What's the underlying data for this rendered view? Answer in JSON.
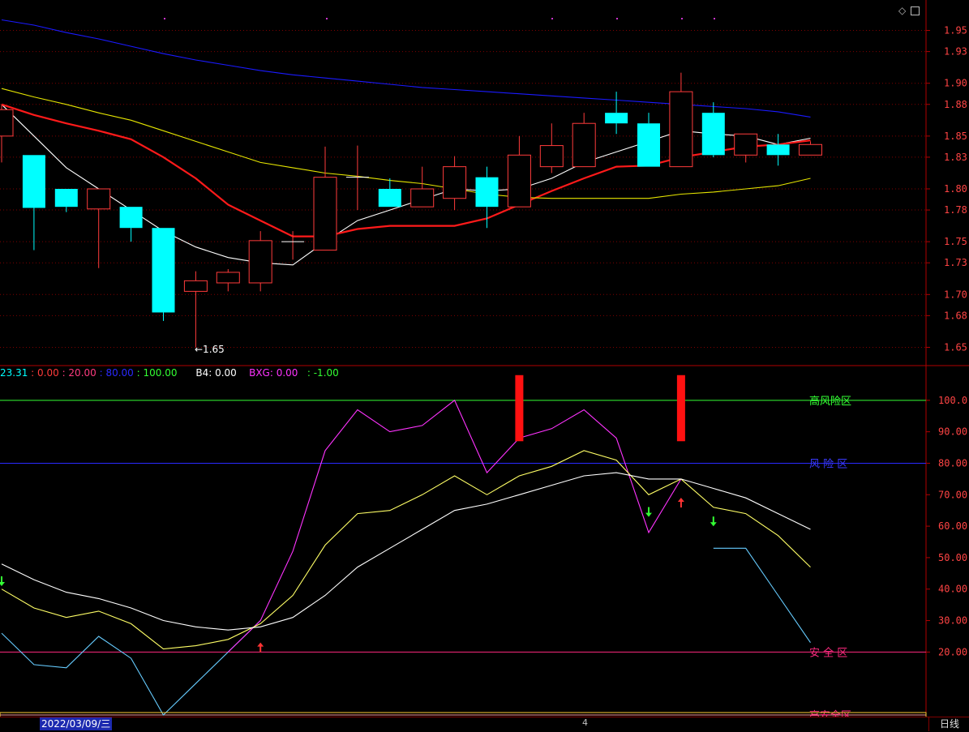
{
  "colors": {
    "up": "#ff3b3b",
    "down": "#00ffff",
    "ma_short": "#ffffff",
    "ma_red": "#ff1a1a",
    "ma_yellow": "#e6e600",
    "ma_blue": "#1a1aff",
    "grid": "#800000",
    "axis": "#b00000",
    "osc_magenta": "#ff33ff",
    "osc_cyan": "#66ccff",
    "osc_yellow": "#ffff66",
    "osc_white": "#ffffff"
  },
  "window_icons": [
    "diamond-icon",
    "restore-icon"
  ],
  "price_axis": {
    "ticks": [
      "1.95",
      "1.93",
      "1.90",
      "1.88",
      "1.85",
      "1.83",
      "1.80",
      "1.78",
      "1.75",
      "1.73",
      "1.70",
      "1.68",
      "1.65"
    ]
  },
  "low_marker": "←1.65",
  "legend": [
    {
      "text": "23.31",
      "color": "#00ffff"
    },
    {
      "text": " : 0.00",
      "color": "#ff3b3b"
    },
    {
      "text": " : 20.00",
      "color": "#ff3b7f"
    },
    {
      "text": " : 80.00",
      "color": "#2a2aff"
    },
    {
      "text": " : 100.00",
      "color": "#33ff33"
    },
    {
      "text": "      B4: 0.00",
      "color": "#ffffff"
    },
    {
      "text": "    BXG: 0.00",
      "color": "#ff33ff"
    },
    {
      "text": "   : -1.00",
      "color": "#33ff33"
    }
  ],
  "osc_axis": {
    "ticks": [
      "100.0",
      "90.00",
      "80.00",
      "70.00",
      "60.00",
      "50.00",
      "40.00",
      "30.00",
      "20.00"
    ]
  },
  "zones": {
    "high_risk": "高风险区",
    "risk": "风 险 区",
    "safe": "安 全 区",
    "high_safe": "高安全区"
  },
  "status": {
    "date": "2022/03/09/三",
    "marker": "4",
    "period": "日线"
  },
  "chart_data": {
    "type": "candlestick",
    "price_ylim": [
      1.635,
      1.965
    ],
    "candles": [
      {
        "o": 1.85,
        "h": 1.88,
        "l": 1.825,
        "c": 1.875
      },
      {
        "o": 1.832,
        "h": 1.832,
        "l": 1.742,
        "c": 1.782
      },
      {
        "o": 1.8,
        "h": 1.8,
        "l": 1.778,
        "c": 1.783
      },
      {
        "o": 1.781,
        "h": 1.8,
        "l": 1.725,
        "c": 1.8
      },
      {
        "o": 1.783,
        "h": 1.783,
        "l": 1.75,
        "c": 1.763
      },
      {
        "o": 1.763,
        "h": 1.763,
        "l": 1.675,
        "c": 1.683
      },
      {
        "o": 1.703,
        "h": 1.722,
        "l": 1.65,
        "c": 1.713
      },
      {
        "o": 1.711,
        "h": 1.724,
        "l": 1.703,
        "c": 1.721
      },
      {
        "o": 1.711,
        "h": 1.76,
        "l": 1.703,
        "c": 1.751
      },
      {
        "o": 1.75,
        "h": 1.76,
        "l": 1.733,
        "c": 1.75
      },
      {
        "o": 1.742,
        "h": 1.84,
        "l": 1.742,
        "c": 1.811
      },
      {
        "o": 1.811,
        "h": 1.841,
        "l": 1.78,
        "c": 1.811
      },
      {
        "o": 1.8,
        "h": 1.81,
        "l": 1.783,
        "c": 1.783
      },
      {
        "o": 1.783,
        "h": 1.821,
        "l": 1.783,
        "c": 1.8
      },
      {
        "o": 1.791,
        "h": 1.831,
        "l": 1.78,
        "c": 1.821
      },
      {
        "o": 1.811,
        "h": 1.821,
        "l": 1.763,
        "c": 1.783
      },
      {
        "o": 1.783,
        "h": 1.85,
        "l": 1.783,
        "c": 1.832
      },
      {
        "o": 1.821,
        "h": 1.862,
        "l": 1.815,
        "c": 1.841
      },
      {
        "o": 1.821,
        "h": 1.872,
        "l": 1.821,
        "c": 1.862
      },
      {
        "o": 1.872,
        "h": 1.892,
        "l": 1.852,
        "c": 1.862
      },
      {
        "o": 1.862,
        "h": 1.872,
        "l": 1.821,
        "c": 1.821
      },
      {
        "o": 1.821,
        "h": 1.91,
        "l": 1.821,
        "c": 1.892
      },
      {
        "o": 1.872,
        "h": 1.882,
        "l": 1.83,
        "c": 1.832
      },
      {
        "o": 1.832,
        "h": 1.852,
        "l": 1.825,
        "c": 1.852
      },
      {
        "o": 1.842,
        "h": 1.852,
        "l": 1.822,
        "c": 1.832
      },
      {
        "o": 1.832,
        "h": 1.845,
        "l": 1.832,
        "c": 1.842
      }
    ],
    "ma": [
      {
        "name": "",
        "color": "#ffffff",
        "values": [
          1.88,
          1.85,
          1.82,
          1.8,
          1.78,
          1.76,
          1.745,
          1.735,
          1.73,
          1.728,
          1.75,
          1.77,
          1.78,
          1.79,
          1.8,
          1.798,
          1.8,
          1.81,
          1.825,
          1.835,
          1.845,
          1.855,
          1.852,
          1.85,
          1.842,
          1.848
        ]
      },
      {
        "name": "",
        "color": "#ff1a1a",
        "values": [
          1.88,
          1.87,
          1.862,
          1.855,
          1.847,
          1.83,
          1.81,
          1.785,
          1.77,
          1.755,
          1.755,
          1.762,
          1.765,
          1.765,
          1.765,
          1.772,
          1.785,
          1.798,
          1.81,
          1.821,
          1.822,
          1.83,
          1.835,
          1.84,
          1.842,
          1.846
        ]
      },
      {
        "name": "",
        "color": "#e6e600",
        "values": [
          1.895,
          1.887,
          1.88,
          1.872,
          1.865,
          1.855,
          1.845,
          1.835,
          1.825,
          1.82,
          1.815,
          1.812,
          1.808,
          1.805,
          1.8,
          1.795,
          1.792,
          1.791,
          1.791,
          1.791,
          1.791,
          1.795,
          1.797,
          1.8,
          1.803,
          1.81
        ]
      },
      {
        "name": "",
        "color": "#1a1aff",
        "values": [
          1.96,
          1.955,
          1.948,
          1.942,
          1.935,
          1.928,
          1.922,
          1.917,
          1.912,
          1.908,
          1.905,
          1.902,
          1.899,
          1.896,
          1.894,
          1.892,
          1.89,
          1.888,
          1.886,
          1.884,
          1.882,
          1.88,
          1.878,
          1.876,
          1.873,
          1.868
        ]
      }
    ],
    "osc_ylim": [
      0,
      110
    ],
    "osc_levels": [
      100,
      80,
      20,
      0
    ],
    "osc_series": [
      {
        "name": "",
        "color": "#66ccff",
        "values": [
          26,
          16,
          15,
          25,
          18,
          0,
          10,
          20,
          30,
          null,
          null,
          null,
          null,
          null,
          null,
          null,
          null,
          null,
          null,
          null,
          null,
          null,
          53,
          53,
          38,
          23
        ]
      },
      {
        "name": "",
        "color": "#ff33ff",
        "values": [
          null,
          null,
          null,
          null,
          null,
          null,
          null,
          20,
          30,
          52,
          84,
          97,
          90,
          92,
          100,
          77,
          88,
          91,
          97,
          88,
          58,
          75,
          null,
          null,
          null,
          null
        ]
      },
      {
        "name": "",
        "color": "#ffff66",
        "values": [
          40,
          34,
          31,
          33,
          29,
          21,
          22,
          24,
          29,
          38,
          54,
          64,
          65,
          70,
          76,
          70,
          76,
          79,
          84,
          81,
          70,
          75,
          66,
          64,
          57,
          47
        ]
      },
      {
        "name": "",
        "color": "#ffffff",
        "values": [
          48,
          43,
          39,
          37,
          34,
          30,
          28,
          27,
          28,
          31,
          38,
          47,
          53,
          59,
          65,
          67,
          70,
          73,
          76,
          77,
          75,
          75,
          72,
          69,
          64,
          59
        ]
      }
    ],
    "red_bars": [
      {
        "index": 16,
        "from": 87,
        "to": 108
      },
      {
        "index": 21,
        "from": 87,
        "to": 108
      }
    ],
    "arrows": [
      {
        "index": 0,
        "value": 42,
        "dir": "down",
        "color": "#33ff33"
      },
      {
        "index": 8,
        "value": 22,
        "dir": "up",
        "color": "#ff3333"
      },
      {
        "index": 20,
        "value": 64,
        "dir": "down",
        "color": "#33ff33"
      },
      {
        "index": 21,
        "value": 68,
        "dir": "up",
        "color": "#ff3333"
      },
      {
        "index": 22,
        "value": 61,
        "dir": "down",
        "color": "#33ff33"
      }
    ]
  }
}
